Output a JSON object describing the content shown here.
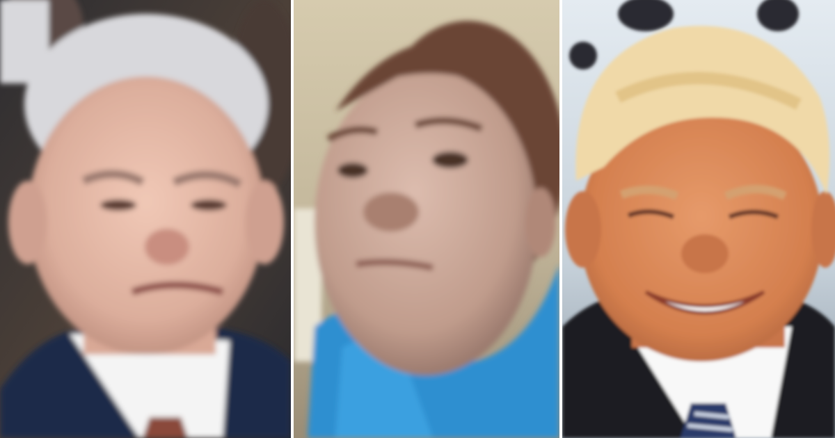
{
  "collage": {
    "panel_count": 3,
    "divider_color": "#ffffff",
    "panels": [
      {
        "subject": "older-man-frowning",
        "background_colors": [
          "#3a3a3c",
          "#5b4a40",
          "#2a2a2e"
        ],
        "skin": "#e4b8a8",
        "hair": "#d8d8dc",
        "suit": "#1f2b4a",
        "shirt": "#ffffff",
        "tie": "#8a4a3a"
      },
      {
        "subject": "young-woman-selfie",
        "background_colors": [
          "#cfc2a4",
          "#e2d7bd",
          "#a89a80"
        ],
        "skin": "#caa796",
        "hair": "#6a4436",
        "hoodie": "#2f8fd0"
      },
      {
        "subject": "older-man-smiling",
        "background_colors": [
          "#d6e1ea",
          "#b9c7d2",
          "#9aa9b6"
        ],
        "skin": "#d98a5a",
        "hair": "#f0d9a8",
        "suit": "#1a1c22",
        "shirt": "#f8f8f8",
        "tie": "#2a3a6a"
      }
    ]
  }
}
